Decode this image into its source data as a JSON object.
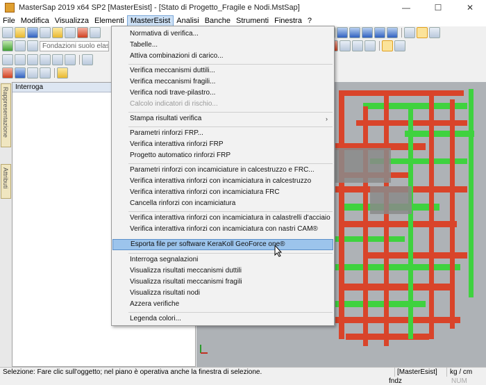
{
  "window": {
    "title": "MasterSap 2019 x64 SP2 [MasterEsist] - [Stato di Progetto_Fragile e Nodi.MstSap]",
    "minimize_glyph": "—",
    "maximize_glyph": "☐",
    "close_glyph": "✕"
  },
  "menubar": {
    "items": [
      "File",
      "Modifica",
      "Visualizza",
      "Elementi",
      "MasterEsist",
      "Analisi",
      "Banche",
      "Strumenti",
      "Finestra",
      "?"
    ]
  },
  "toolbar": {
    "combo_value": "Fondazioni suolo elasti"
  },
  "left_tabs": {
    "representation": "Rappresentazione",
    "attributes": "Attributi"
  },
  "panel": {
    "title": "Interroga"
  },
  "dropdown": {
    "items": [
      {
        "label": "Normativa di verifica...",
        "disabled": false
      },
      {
        "label": "Tabelle...",
        "disabled": false
      },
      {
        "label": "Attiva combinazioni di carico...",
        "disabled": false
      },
      {
        "label": "Verifica meccanismi duttili...",
        "disabled": false
      },
      {
        "label": "Verifica meccanismi fragili...",
        "disabled": false
      },
      {
        "label": "Verifica nodi trave-pilastro...",
        "disabled": false
      },
      {
        "label": "Calcolo indicatori di rischio...",
        "disabled": true
      },
      {
        "label": "Stampa risultati verifica",
        "disabled": false,
        "submenu": true
      },
      {
        "label": "Parametri rinforzi FRP...",
        "disabled": false
      },
      {
        "label": "Verifica interattiva rinforzi FRP",
        "disabled": false
      },
      {
        "label": "Progetto automatico rinforzi FRP",
        "disabled": false
      },
      {
        "label": "Parametri rinforzi con incamiciature in calcestruzzo e FRC...",
        "disabled": false
      },
      {
        "label": "Verifica interattiva rinforzi con incamiciatura in calcestruzzo",
        "disabled": false
      },
      {
        "label": "Verifica interattiva rinforzi con incamiciatura FRC",
        "disabled": false
      },
      {
        "label": "Cancella rinforzi con incamiciatura",
        "disabled": false
      },
      {
        "label": "Verifica interattiva rinforzi con incamiciatura in calastrelli d'acciaio",
        "disabled": false
      },
      {
        "label": "Verifica interattiva rinforzi con incamiciatura con nastri CAM®",
        "disabled": false
      },
      {
        "label": "Esporta file per software KeraKoll GeoForce one®",
        "disabled": false,
        "highlighted": true
      },
      {
        "label": "Interroga segnalazioni",
        "disabled": false
      },
      {
        "label": "Visualizza risultati meccanismi duttili",
        "disabled": false
      },
      {
        "label": "Visualizza risultati meccanismi fragili",
        "disabled": false
      },
      {
        "label": "Visualizza risultati nodi",
        "disabled": false
      },
      {
        "label": "Azzera verifiche",
        "disabled": false
      },
      {
        "label": "Legenda colori...",
        "disabled": false
      }
    ],
    "submenu_arrow": "›"
  },
  "statusbar": {
    "message": "Selezione: Fare clic sull'oggetto; nel piano è operativa anche la finestra di selezione.",
    "mode": "[MasterEsist]",
    "units": "kg / cm",
    "function": "fndz",
    "num": "NUM"
  },
  "colors": {
    "beam_red": "#d9442a",
    "beam_green": "#3fd23f",
    "beam_gray": "#8a8a8a",
    "viewport_bg": "#aeb2b6",
    "menu_highlight": "#9cc4ec"
  }
}
